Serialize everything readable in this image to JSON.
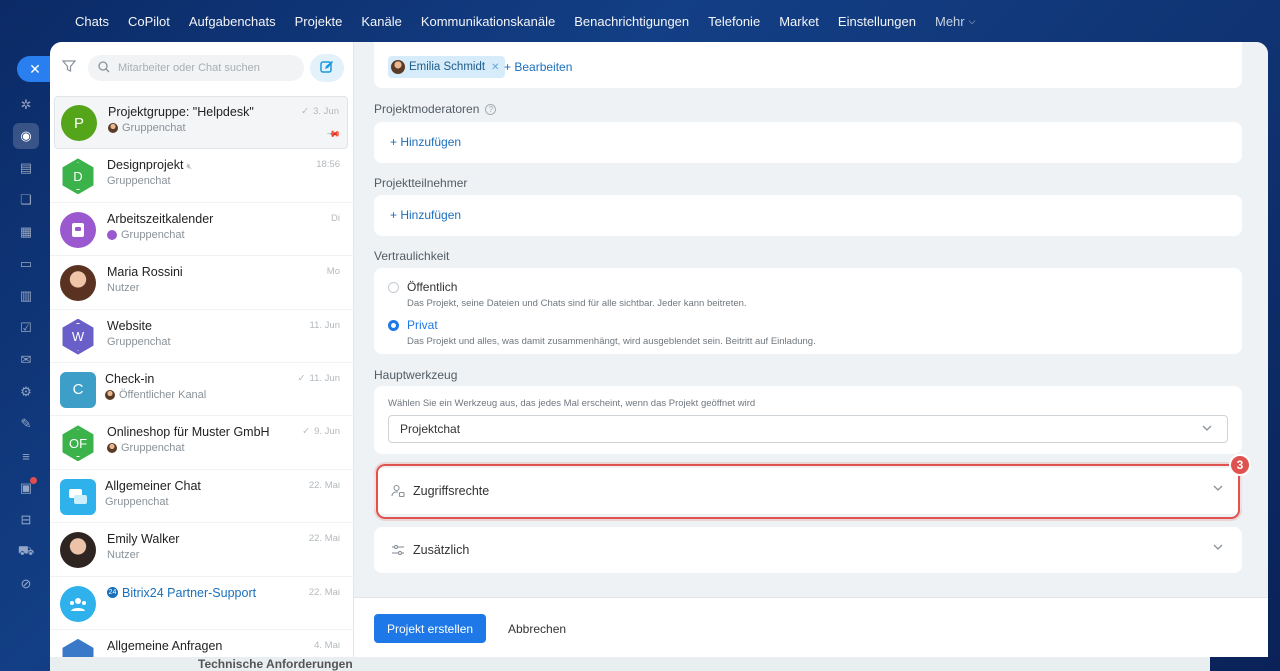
{
  "topnav": {
    "items": [
      "Chats",
      "CoPilot",
      "Aufgabenchats",
      "Projekte",
      "Kanäle",
      "Kommunikationskanäle",
      "Benachrichtigungen",
      "Telefonie",
      "Market",
      "Einstellungen"
    ],
    "more": "Mehr"
  },
  "sidebar": {
    "icons": [
      "copilot-icon",
      "chat-icon",
      "tasks-icon",
      "channels-icon",
      "calendar-icon",
      "drive-icon",
      "feed-icon",
      "checklist-icon",
      "mail-icon",
      "settings-icon",
      "sign-icon",
      "filter-icon",
      "notifications-icon",
      "storage-icon",
      "market-icon",
      "automation-icon"
    ]
  },
  "search": {
    "placeholder": "Mitarbeiter oder Chat suchen"
  },
  "chats": [
    {
      "title": "Projektgruppe: \"Helpdesk\"",
      "sub": "Gruppenchat",
      "date": "3. Jun",
      "avatar": "P",
      "color": "#55a51b"
    },
    {
      "title": "Designprojekt",
      "sub": "Gruppenchat",
      "date": "18:56",
      "avatar": "D",
      "color": "#3bb34a"
    },
    {
      "title": "Arbeitszeitkalender",
      "sub": "Gruppenchat",
      "date": "Di",
      "avatar": "",
      "color": "#9b59d0"
    },
    {
      "title": "Maria Rossini",
      "sub": "Nutzer",
      "date": "Mo",
      "avatar": "",
      "color": "#6b4a3a"
    },
    {
      "title": "Website",
      "sub": "Gruppenchat",
      "date": "11. Jun",
      "avatar": "W",
      "color": "#6a5ec8"
    },
    {
      "title": "Check-in",
      "sub": "Öffentlicher Kanal",
      "date": "11. Jun",
      "avatar": "C",
      "color": "#3d9fc8"
    },
    {
      "title": "Onlineshop für Muster GmbH",
      "sub": "Gruppenchat",
      "date": "9. Jun",
      "avatar": "OF",
      "color": "#3bb34a"
    },
    {
      "title": "Allgemeiner Chat",
      "sub": "Gruppenchat",
      "date": "22. Mai",
      "avatar": "",
      "color": "#2fb1ec"
    },
    {
      "title": "Emily Walker",
      "sub": "Nutzer",
      "date": "22. Mai",
      "avatar": "",
      "color": "#3a3a3a"
    },
    {
      "title": "Bitrix24 Partner-Support",
      "sub": "",
      "date": "22. Mai",
      "avatar": "",
      "color": "#2fb1ec"
    },
    {
      "title": "Allgemeine Anfragen",
      "sub": "",
      "date": "4. Mai",
      "avatar": "",
      "color": "#3a78c8"
    }
  ],
  "form": {
    "owner_chip": "Emilia Schmidt",
    "edit": "+ Bearbeiten",
    "moderators_label": "Projektmoderatoren",
    "add": "+ Hinzufügen",
    "participants_label": "Projektteilnehmer",
    "privacy_label": "Vertraulichkeit",
    "public_title": "Öffentlich",
    "public_desc": "Das Projekt, seine Dateien und Chats sind für alle sichtbar. Jeder kann beitreten.",
    "private_title": "Privat",
    "private_desc": "Das Projekt und alles, was damit zusammenhängt, wird ausgeblendet sein. Beitritt auf Einladung.",
    "tool_label": "Hauptwerkzeug",
    "tool_hint": "Wählen Sie ein Werkzeug aus, das jedes Mal erscheint, wenn das Projekt geöffnet wird",
    "tool_value": "Projektchat",
    "access_rights": "Zugriffsrechte",
    "additional": "Zusätzlich",
    "step": "3"
  },
  "footer": {
    "create": "Projekt erstellen",
    "cancel": "Abbrechen"
  },
  "background_text": "Technische Anforderungen",
  "colors": {
    "accent": "#1e78e8",
    "link": "#1a6fbd",
    "highlight": "#e0524f"
  }
}
